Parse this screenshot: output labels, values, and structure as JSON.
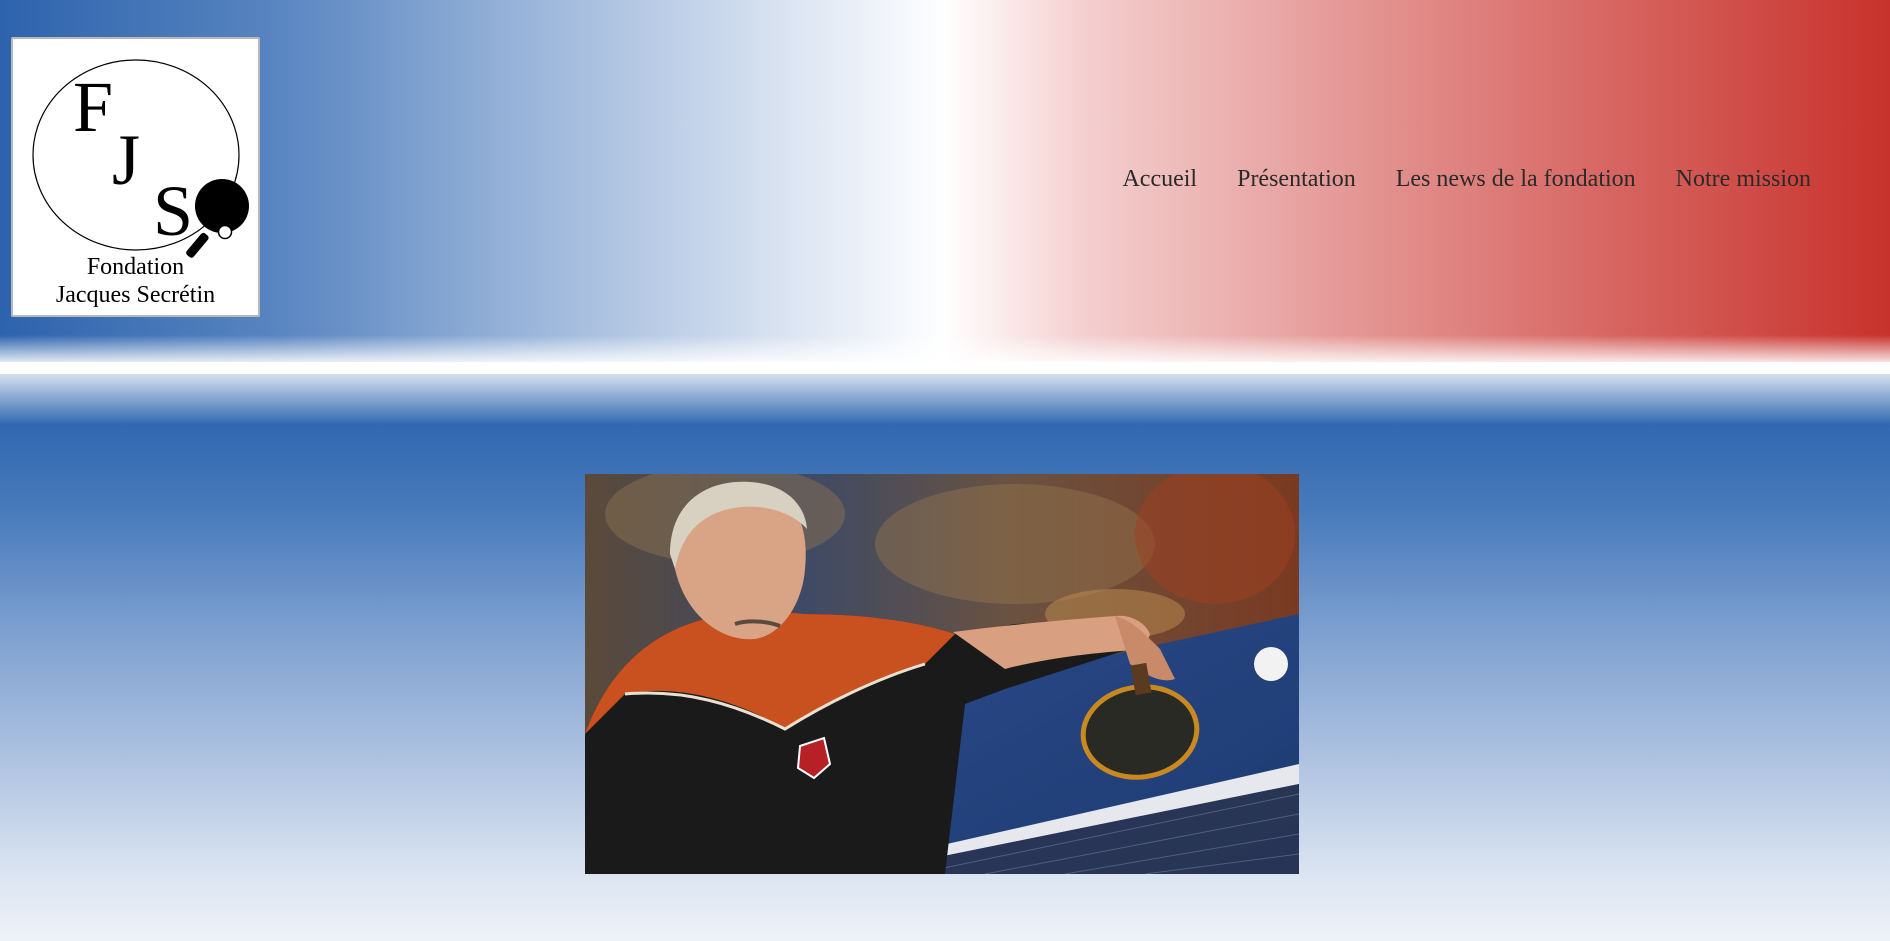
{
  "logo": {
    "letters": [
      "F",
      "J",
      "S"
    ],
    "caption_line1": "Fondation",
    "caption_line2": "Jacques Secrétin"
  },
  "nav": {
    "items": [
      {
        "label": "Accueil"
      },
      {
        "label": "Présentation"
      },
      {
        "label": "Les news de la fondation"
      },
      {
        "label": "Notre mission"
      }
    ]
  },
  "hero": {
    "icon": "table-tennis-player-photo"
  },
  "colors": {
    "header_left": "#2d63ad",
    "header_right": "#c8322c",
    "main_top": "#3068b0",
    "main_bottom": "#eef2f8"
  }
}
